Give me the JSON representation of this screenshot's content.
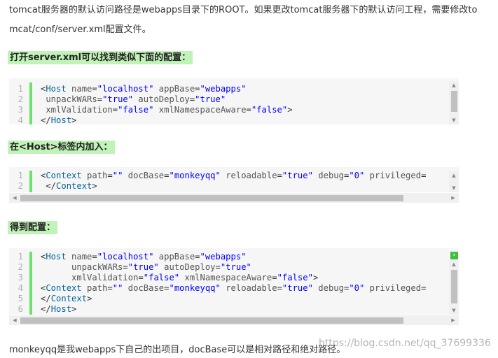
{
  "intro": {
    "line1": "tomcat服务器的默认访问路径是webapps目录下的ROOT。如果更改tomcat服务器下的默认访问工程，需要修改to",
    "line2": "mcat/conf/server.xml配置文件。"
  },
  "heading1": "打开server.xml可以找到类似下面的配置：",
  "block1": {
    "numbers": [
      "1",
      "2",
      "3",
      "4"
    ],
    "lines": [
      [
        [
          "p",
          "<"
        ],
        [
          "t",
          "Host"
        ],
        [
          "a",
          " name"
        ],
        [
          "p",
          "="
        ],
        [
          "v",
          "\"localhost\""
        ],
        [
          "a",
          " appBase"
        ],
        [
          "p",
          "="
        ],
        [
          "v",
          "\"webapps\""
        ]
      ],
      [
        [
          "a",
          " unpackWARs"
        ],
        [
          "p",
          "="
        ],
        [
          "v",
          "\"true\""
        ],
        [
          "a",
          " autoDeploy"
        ],
        [
          "p",
          "="
        ],
        [
          "v",
          "\"true\""
        ]
      ],
      [
        [
          "a",
          " xmlValidation"
        ],
        [
          "p",
          "="
        ],
        [
          "v",
          "\"false\""
        ],
        [
          "a",
          " xmlNamespaceAware"
        ],
        [
          "p",
          "="
        ],
        [
          "v",
          "\"false\""
        ],
        [
          "p",
          ">"
        ]
      ],
      [
        [
          "p",
          "</"
        ],
        [
          "t",
          "Host"
        ],
        [
          "p",
          ">"
        ]
      ]
    ]
  },
  "heading2": "在<Host>标签内加入：",
  "block2": {
    "numbers": [
      "1",
      "2"
    ],
    "lines": [
      [
        [
          "p",
          "<"
        ],
        [
          "t",
          "Context"
        ],
        [
          "a",
          " path"
        ],
        [
          "p",
          "="
        ],
        [
          "v",
          "\"\""
        ],
        [
          "a",
          " docBase"
        ],
        [
          "p",
          "="
        ],
        [
          "v",
          "\"monkeyqq\""
        ],
        [
          "a",
          " reloadable"
        ],
        [
          "p",
          "="
        ],
        [
          "v",
          "\"true\""
        ],
        [
          "a",
          " debug"
        ],
        [
          "p",
          "="
        ],
        [
          "v",
          "\"0\""
        ],
        [
          "a",
          " privileged"
        ],
        [
          "p",
          "="
        ]
      ],
      [
        [
          "p",
          " </"
        ],
        [
          "t",
          "Context"
        ],
        [
          "p",
          ">"
        ]
      ]
    ]
  },
  "heading3": "得到配置：",
  "block3": {
    "numbers": [
      "1",
      "2",
      "3",
      "4",
      "5",
      "6"
    ],
    "lines": [
      [
        [
          "p",
          "<"
        ],
        [
          "t",
          "Host"
        ],
        [
          "a",
          " name"
        ],
        [
          "p",
          "="
        ],
        [
          "v",
          "\"localhost\""
        ],
        [
          "a",
          " appBase"
        ],
        [
          "p",
          "="
        ],
        [
          "v",
          "\"webapps\""
        ]
      ],
      [
        [
          "a",
          "      unpackWARs"
        ],
        [
          "p",
          "="
        ],
        [
          "v",
          "\"true\""
        ],
        [
          "a",
          " autoDeploy"
        ],
        [
          "p",
          "="
        ],
        [
          "v",
          "\"true\""
        ]
      ],
      [
        [
          "a",
          "      xmlValidation"
        ],
        [
          "p",
          "="
        ],
        [
          "v",
          "\"false\""
        ],
        [
          "a",
          " xmlNamespaceAware"
        ],
        [
          "p",
          "="
        ],
        [
          "v",
          "\"false\""
        ],
        [
          "p",
          ">"
        ]
      ],
      [
        [
          "p",
          "<"
        ],
        [
          "t",
          "Context"
        ],
        [
          "a",
          " path"
        ],
        [
          "p",
          "="
        ],
        [
          "v",
          "\"\""
        ],
        [
          "a",
          " docBase"
        ],
        [
          "p",
          "="
        ],
        [
          "v",
          "\"monkeyqq\""
        ],
        [
          "a",
          " reloadable"
        ],
        [
          "p",
          "="
        ],
        [
          "v",
          "\"true\""
        ],
        [
          "a",
          " debug"
        ],
        [
          "p",
          "="
        ],
        [
          "v",
          "\"0\""
        ],
        [
          "a",
          " privileged"
        ],
        [
          "p",
          "="
        ]
      ],
      [
        [
          "p",
          "</"
        ],
        [
          "t",
          "Context"
        ],
        [
          "p",
          ">"
        ]
      ],
      [
        [
          "p",
          "</"
        ],
        [
          "t",
          "Host"
        ],
        [
          "p",
          ">"
        ]
      ]
    ]
  },
  "footer": "monkeyqq是我webapps下自己的出项目，docBase可以是相对路径和绝对路径。",
  "watermark": "https://blog.csdn.net/qq_37699336",
  "icons": {
    "copy": "code-toggle-icon",
    "scroll_up": "arrow-up-icon",
    "scroll_down": "arrow-down-icon",
    "scroll_left": "arrow-left-icon",
    "scroll_right": "arrow-right-icon"
  },
  "colors": {
    "heading_bg": "#c1f3b8",
    "gutter": "#6ce26c",
    "tag": "#006699",
    "attr_value": "#0000ff"
  }
}
